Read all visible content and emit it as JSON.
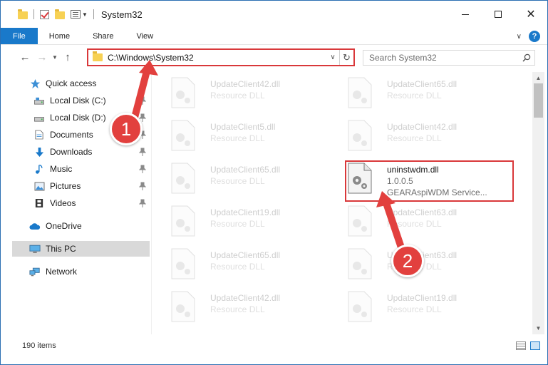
{
  "window": {
    "title": "System32",
    "minimize_label": "—",
    "close_label": "✕"
  },
  "ribbon": {
    "tabs": [
      {
        "label": "File"
      },
      {
        "label": "Home"
      },
      {
        "label": "Share"
      },
      {
        "label": "View"
      }
    ]
  },
  "navigation": {
    "address": "C:\\Windows\\System32",
    "search_placeholder": "Search System32"
  },
  "sidebar": {
    "items": [
      {
        "label": "Quick access"
      },
      {
        "label": "Local Disk (C:)"
      },
      {
        "label": "Local Disk (D:)"
      },
      {
        "label": "Documents"
      },
      {
        "label": "Downloads"
      },
      {
        "label": "Music"
      },
      {
        "label": "Pictures"
      },
      {
        "label": "Videos"
      },
      {
        "label": "OneDrive"
      },
      {
        "label": "This PC"
      },
      {
        "label": "Network"
      }
    ]
  },
  "files": {
    "left": [
      {
        "name": "UpdateClient42.dll",
        "type": "Resource DLL"
      },
      {
        "name": "UpdateClient5.dll",
        "type": "Resource DLL"
      },
      {
        "name": "UpdateClient65.dll",
        "type": "Resource DLL"
      },
      {
        "name": "UpdateClient19.dll",
        "type": "Resource DLL"
      },
      {
        "name": "UpdateClient65.dll",
        "type": "Resource DLL"
      },
      {
        "name": "UpdateClient42.dll",
        "type": "Resource DLL"
      }
    ],
    "right": [
      {
        "name": "UpdateClient65.dll",
        "type": "Resource DLL"
      },
      {
        "name": "UpdateClient42.dll",
        "type": "Resource DLL"
      },
      {
        "name": "uninstwdm.dll",
        "version": "1.0.0.5",
        "description": "GEARAspiWDM Service..."
      },
      {
        "name": "UpdateClient63.dll",
        "type": "Resource DLL"
      },
      {
        "name": "UpdateClient63.dll",
        "type": "Resource DLL"
      },
      {
        "name": "UpdateClient19.dll",
        "type": "Resource DLL"
      }
    ]
  },
  "status": {
    "item_count": "190 items"
  },
  "annotations": {
    "step1": "1",
    "step2": "2",
    "color": "#e2403e"
  }
}
